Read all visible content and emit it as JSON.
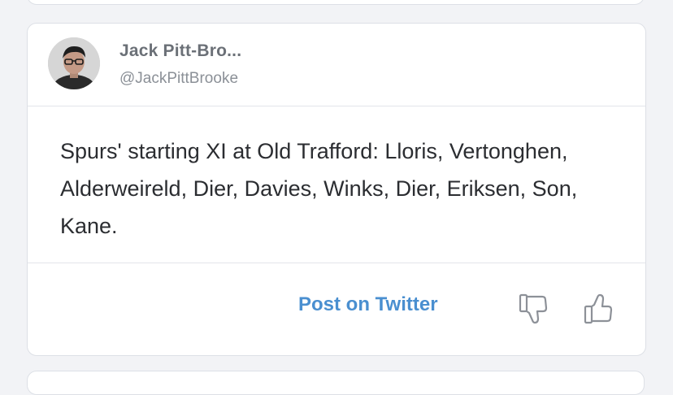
{
  "tweet": {
    "author_name": "Jack Pitt-Bro...",
    "author_handle": "@JackPittBrooke",
    "text": "Spurs' starting XI at Old Trafford: Lloris, Vertonghen, Alderweireld, Dier, Davies, Winks, Dier, Eriksen, Son, Kane.",
    "link_color": "#4a8fd0"
  },
  "footer": {
    "post_label": "Post on Twitter",
    "thumbs_down_icon": "thumbs-down-icon",
    "thumbs_up_icon": "thumbs-up-icon"
  }
}
